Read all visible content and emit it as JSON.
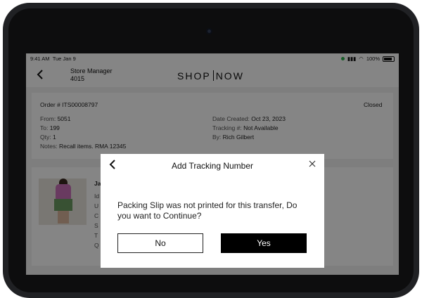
{
  "status_bar": {
    "time": "9:41 AM",
    "date": "Tue Jan 9",
    "battery": "100%"
  },
  "header": {
    "title": "Store Manager",
    "store_number": "4015",
    "logo_left": "SHOP",
    "logo_right": "NOW"
  },
  "order": {
    "order_label": "Order # ITS00008797",
    "status": "Closed",
    "from_label": "From:",
    "from": "5051",
    "to_label": "To:",
    "to": "199",
    "qty_label": "Qty:",
    "qty": "1",
    "notes_label": "Notes:",
    "notes": "Recall items. RMA 12345",
    "date_label": "Date Created:",
    "date": "Oct 23, 2023",
    "tracking_label": "Tracking #:",
    "tracking": "Not Available",
    "by_label": "By:",
    "by": "Rich Gilbert"
  },
  "item": {
    "title_partial": "Ja",
    "labels": [
      "Id",
      "U",
      "C",
      "S",
      "T",
      "Q"
    ]
  },
  "modal": {
    "title": "Add Tracking Number",
    "message": "Packing Slip was not printed for this transfer, Do you want to Continue?",
    "no_label": "No",
    "yes_label": "Yes"
  },
  "colors": {
    "overlay": "#000000",
    "primary_button": "#000000",
    "signal": "#2bb24c"
  }
}
